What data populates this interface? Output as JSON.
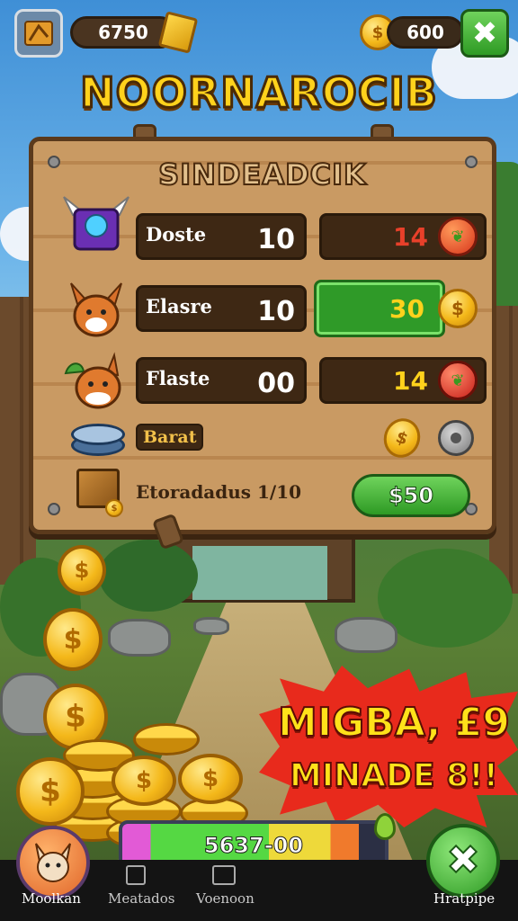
{
  "top_bar": {
    "left_counter": "6750",
    "right_counter": "600"
  },
  "title": "NOORNAROCIB",
  "board": {
    "heading": "SINDEADCIK",
    "rows": [
      {
        "label": "Doste",
        "left_value": "10",
        "right_value": "14",
        "right_color": "#e8402a",
        "icon": "winged-gem-icon",
        "item_icon": "apple-icon"
      },
      {
        "label": "Elasre",
        "left_value": "10",
        "right_value": "30",
        "right_color": "#ffd21c",
        "icon": "fox-icon",
        "item_icon": "coin-icon",
        "active": true
      },
      {
        "label": "Flaste",
        "left_value": "00",
        "right_value": "14",
        "right_color": "#ffd21c",
        "icon": "fox-leaf-icon",
        "item_icon": "apple-icon"
      }
    ],
    "bonus_tag": "Barat",
    "footer_text": "Etoradadus 1/10",
    "price_button": "$50"
  },
  "promo": {
    "line1": "MIGBA, £9",
    "line2": "MINADE 8!!"
  },
  "progress": {
    "text": "5637-00",
    "fill_fraction": 0.9
  },
  "nav": {
    "items": [
      "Moolkan",
      "Meatados",
      "Voenoon"
    ],
    "right_label": "Hratpipe"
  },
  "colors": {
    "title_yellow": "#ffd21c",
    "wood": "#c99a63",
    "dark_wood": "#3e2814",
    "active_green": "#2f9a28",
    "burst_red": "#e82a1c"
  }
}
